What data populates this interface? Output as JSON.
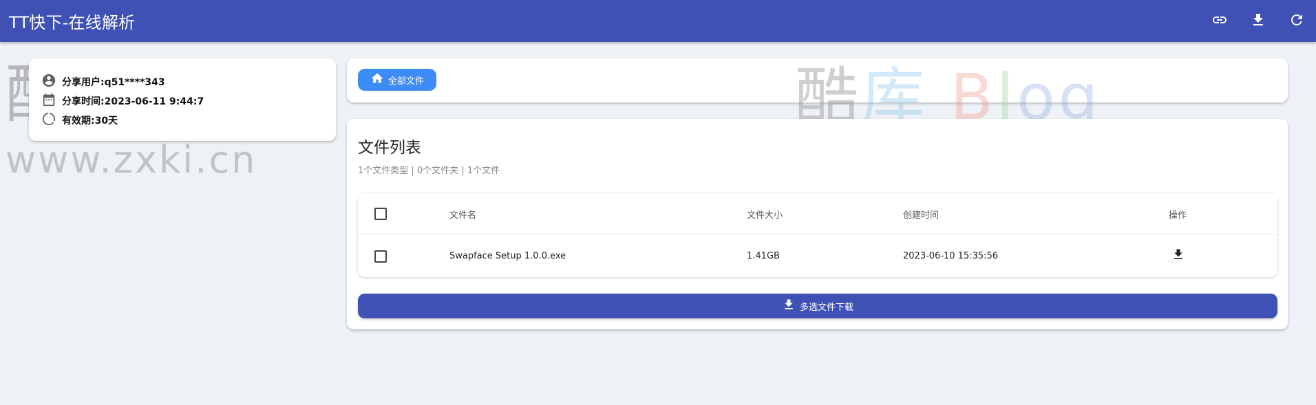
{
  "app": {
    "title": "TT快下-在线解析",
    "actions": [
      {
        "name": "link-icon"
      },
      {
        "name": "download-icon"
      },
      {
        "name": "refresh-icon"
      }
    ]
  },
  "share_info": {
    "user": "分享用户:q51****343",
    "time": "分享时间:2023-06-11 9:44:7",
    "validity": "有效期:30天"
  },
  "nav": {
    "all_files_label": "全部文件"
  },
  "file_list": {
    "title": "文件列表",
    "summary": "1个文件类型 | 0个文件夹 | 1个文件",
    "columns": {
      "name": "文件名",
      "size": "文件大小",
      "created": "创建时间",
      "action": "操作"
    },
    "rows": [
      {
        "name": "Swapface Setup 1.0.0.exe",
        "size": "1.41GB",
        "created": "2023-06-10 15:35:56"
      }
    ],
    "multi_download_label": "多选文件下载"
  },
  "watermark": {
    "brand_chars": [
      "酷",
      "库",
      "B",
      "l",
      "o",
      "g"
    ],
    "url": "www.zxki.cn"
  },
  "colors": {
    "appbar": "#3f51b5",
    "chip": "#3d8bf5",
    "background": "#eef1f5"
  }
}
